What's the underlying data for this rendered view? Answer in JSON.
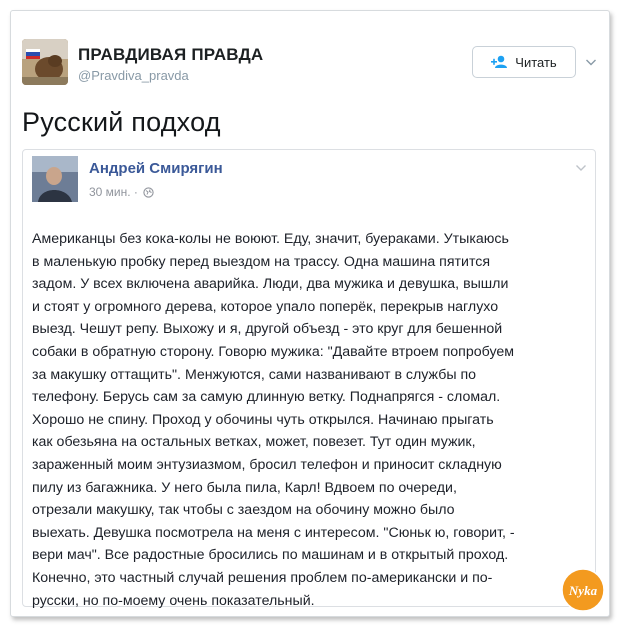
{
  "account": {
    "display_name": "ПРАВДИВАЯ ПРАВДА",
    "handle": "@Pravdiva_pravda",
    "follow_label": "Читать"
  },
  "tweet": {
    "text": "Русский подход"
  },
  "quoted_post": {
    "author": "Андрей Смирягин",
    "time": "30 мин. ·",
    "body": "Американцы без кока-колы не воюют. Еду, значит, буераками. Утыкаюсь\nв маленькую пробку перед выездом на трассу. Одна машина пятится\nзадом. У всех включена аварийка. Люди, два мужика и девушка, вышли\nи стоят у огромного дерева, которое упало поперёк, перекрыв наглухо\nвыезд. Чешут репу. Выхожу и я, другой объезд - это круг для бешенной\nсобаки в обратную сторону. Говорю мужика: \"Давайте втроем попробуем\nза макушку оттащить\". Менжуются, сами названивают в службы по\nтелефону. Берусь сам за самую длинную ветку. Поднапрягся - сломал.\nХорошо не спину. Проход у обочины чуть открылся. Начинаю прыгать\nкак обезьяна на остальных ветках, может, повезет. Тут один мужик,\nзараженный моим энтузиазмом, бросил телефон и приносит складную\nпилу из багажника. У него была пила, Карл! Вдвоем по очереди,\nотрезали макушку, так чтобы с заездом на обочину можно было\nвыехать. Девушка посмотрела на меня с интересом. \"Сюньк ю, говорит, -\nвери мач\". Все радостные бросились по машинам и в открытый проход.\nКонечно, это частный случай решения проблем по-американски и по-\nрусски, но по-моему очень показательный."
  },
  "watermark": {
    "text": "Nyka"
  },
  "icons": {
    "follow": "follow-person-icon",
    "caret": "chevron-down-icon",
    "globe": "globe-icon"
  },
  "colors": {
    "fb_link": "#3b5998",
    "muted": "#8899a6",
    "badge": "#f39a1f"
  }
}
